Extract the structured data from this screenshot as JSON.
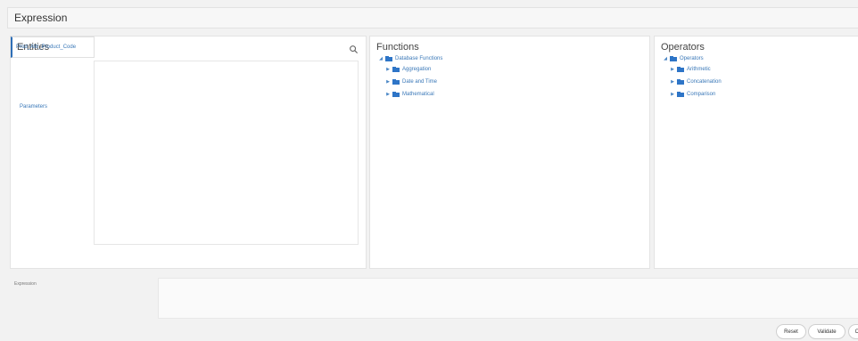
{
  "header": {
    "title": "Expression"
  },
  "entities": {
    "title": "Entities",
    "items": [
      "Prod_Attr_Product_Code",
      "Parameters"
    ]
  },
  "functions": {
    "title": "Functions",
    "root": "Database Functions",
    "children": [
      "Aggregation",
      "Date and Time",
      "Mathematical"
    ]
  },
  "operators": {
    "title": "Operators",
    "root": "Operators",
    "children": [
      "Arithmetic",
      "Concatenation",
      "Comparison"
    ]
  },
  "expression": {
    "label": "Expression",
    "value": ""
  },
  "buttons": {
    "reset": "Reset",
    "validate": "Validate",
    "ok": "OK"
  },
  "icons": {
    "search": "search-icon",
    "folder": "folder-icon"
  },
  "colors": {
    "accent": "#2e6fb7",
    "link": "#3a78b8"
  }
}
